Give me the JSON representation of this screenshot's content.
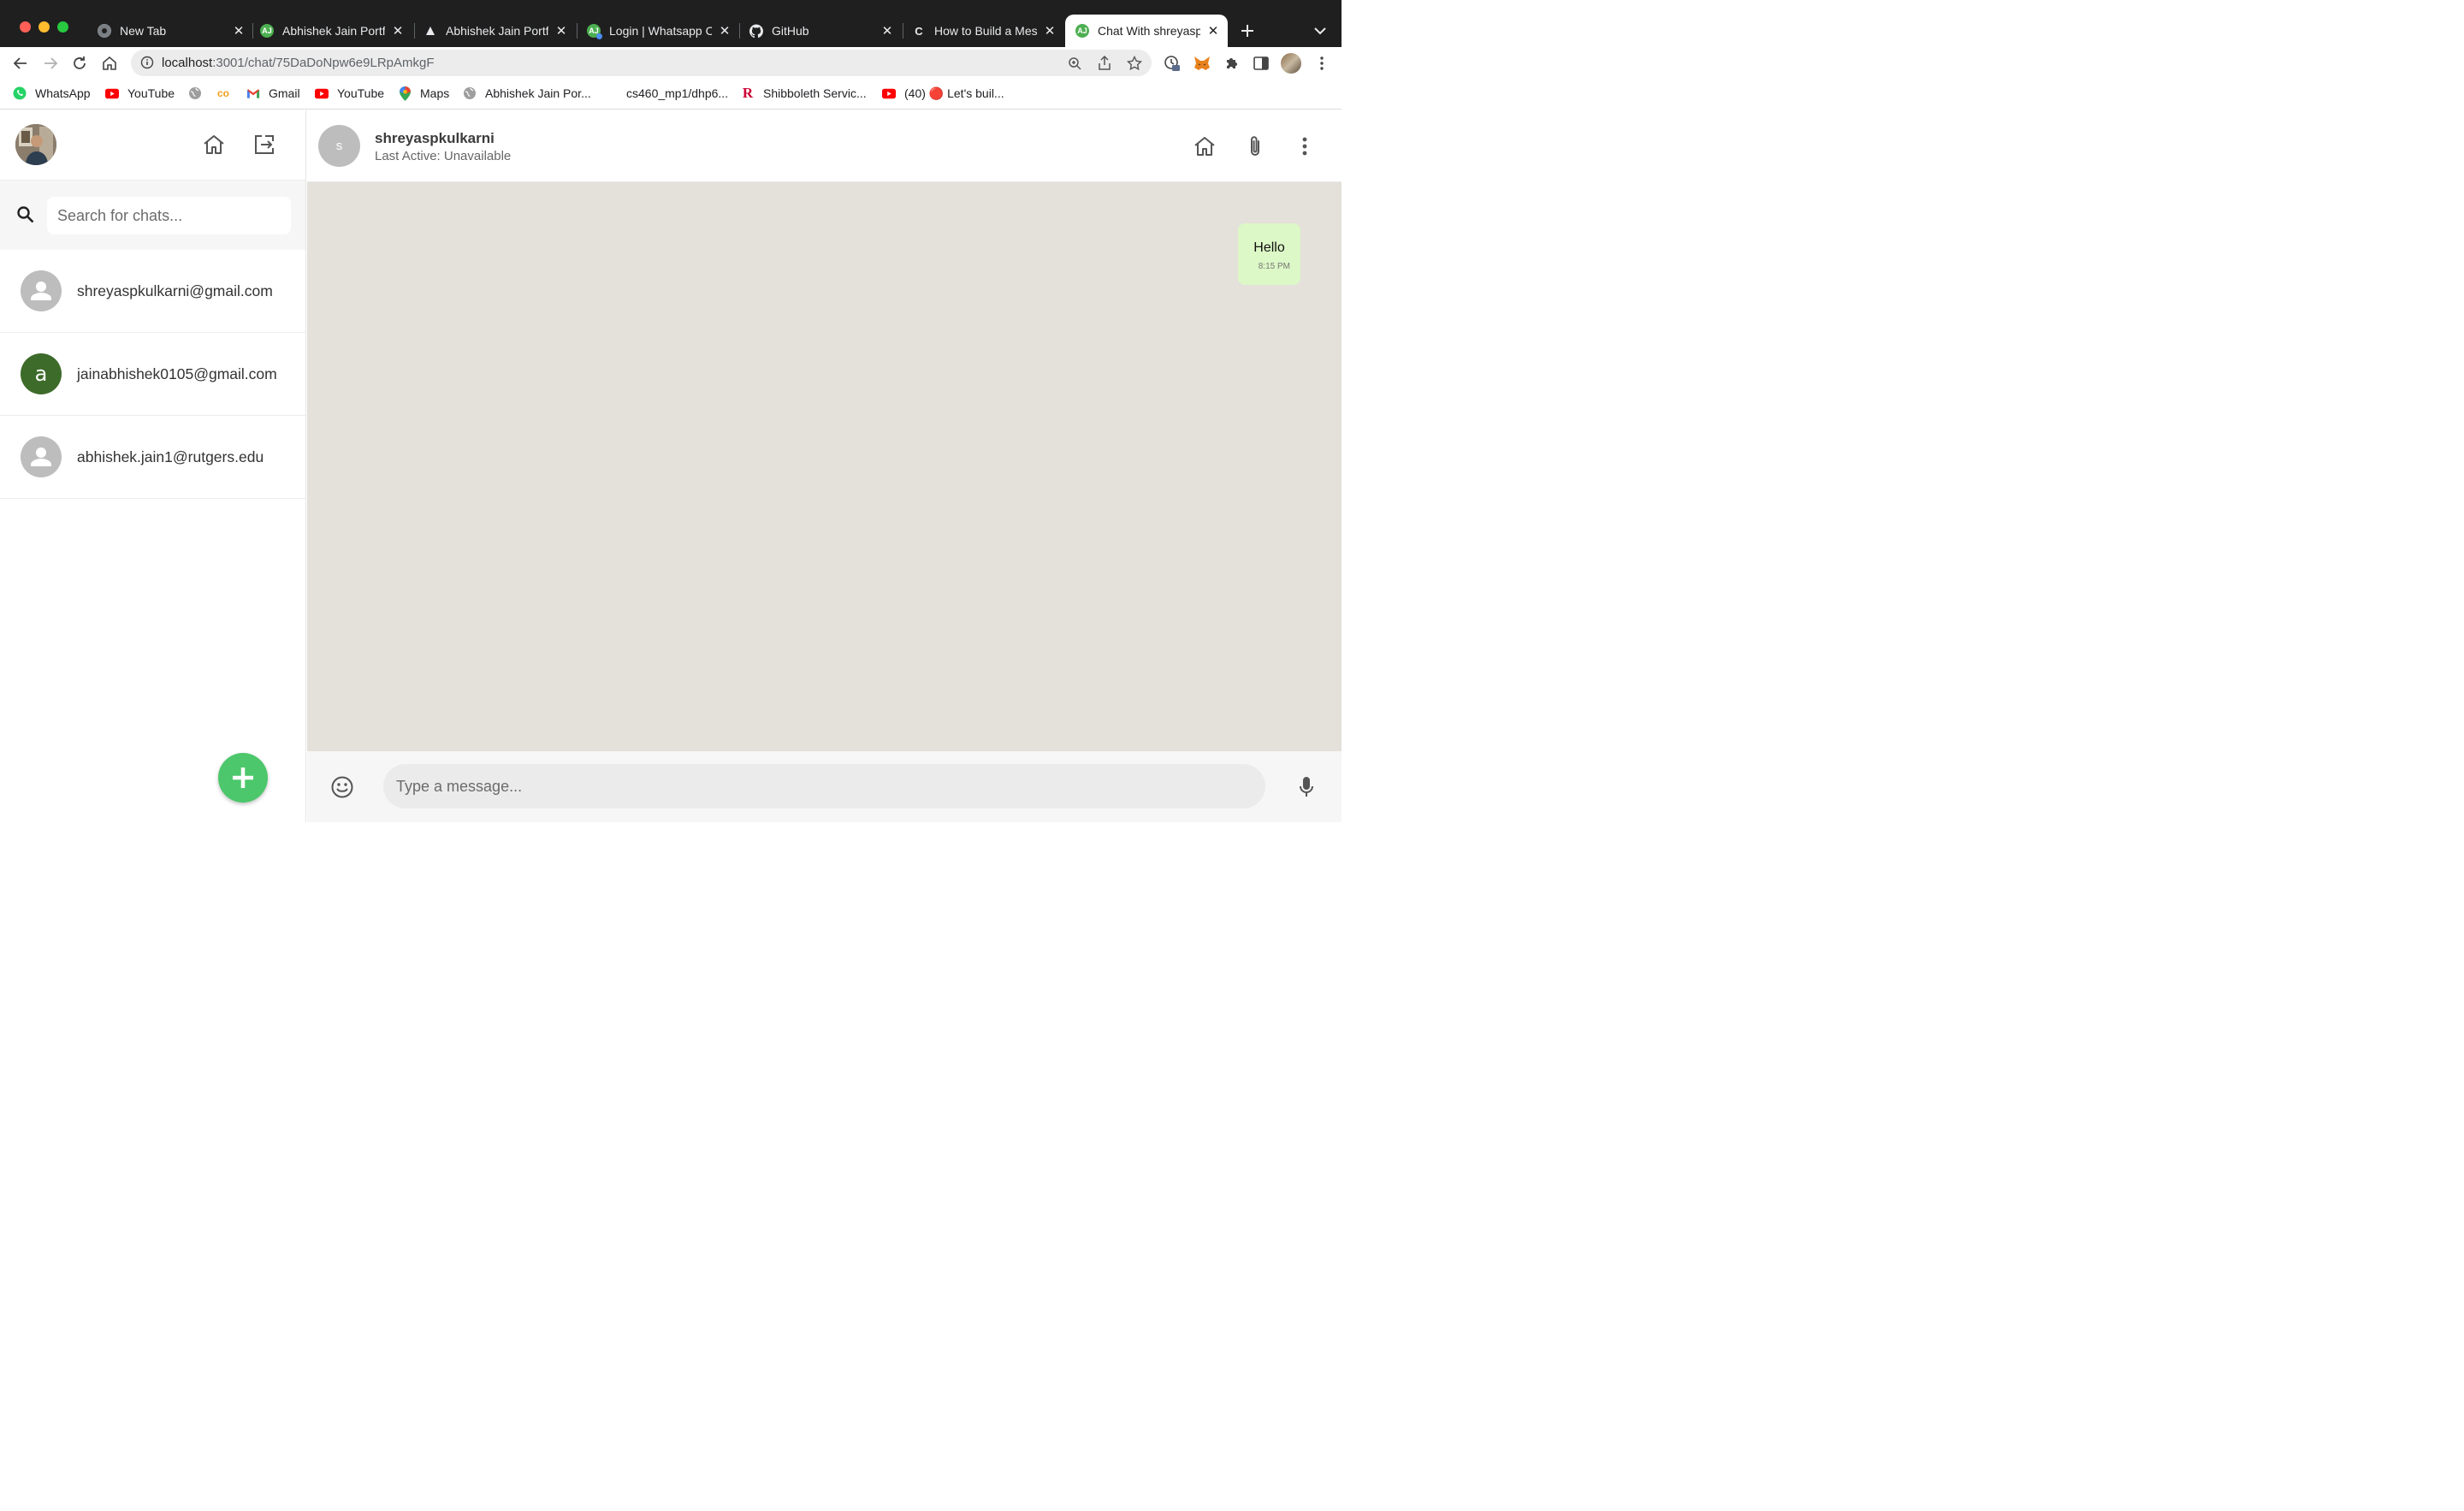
{
  "browser": {
    "tabs": [
      {
        "title": "New Tab",
        "icon": "chrome-icon"
      },
      {
        "title": "Abhishek Jain Portfolio",
        "icon": "portfolio-favicon"
      },
      {
        "title": "Abhishek Jain Portfolio",
        "icon": "vercel-triangle-icon"
      },
      {
        "title": "Login | Whatsapp Clone",
        "icon": "whatsapp-clone-favicon"
      },
      {
        "title": "GitHub",
        "icon": "github-icon"
      },
      {
        "title": "How to Build a Messaging App",
        "icon": "codecademy-icon"
      },
      {
        "title": "Chat With shreyaspkulkarni",
        "icon": "whatsapp-clone-favicon",
        "active": true
      }
    ],
    "url": {
      "host": "localhost",
      "path": ":3001/chat/75DaDoNpw6e9LRpAmkgF"
    },
    "bookmarks": [
      {
        "label": "WhatsApp",
        "icon": "whatsapp-icon"
      },
      {
        "label": "YouTube",
        "icon": "youtube-icon"
      },
      {
        "label": "",
        "icon": "globe-icon"
      },
      {
        "label": "",
        "icon": "coursera-icon"
      },
      {
        "label": "Gmail",
        "icon": "gmail-icon"
      },
      {
        "label": "YouTube",
        "icon": "youtube-icon"
      },
      {
        "label": "Maps",
        "icon": "maps-icon"
      },
      {
        "label": "Abhishek Jain Por...",
        "icon": "globe-icon"
      },
      {
        "label": "cs460_mp1/dhp6...",
        "icon": ""
      },
      {
        "label": "Shibboleth Servic...",
        "icon": "rutgers-icon"
      },
      {
        "label": "(40) 🔴 Let's buil...",
        "icon": "youtube-icon"
      }
    ]
  },
  "sidebar": {
    "search_placeholder": "Search for chats...",
    "chats": [
      {
        "name": "shreyaspkulkarni@gmail.com",
        "avatar": "person-icon"
      },
      {
        "name": "jainabhishek0105@gmail.com",
        "avatar_letter": "a"
      },
      {
        "name": "abhishek.jain1@rutgers.edu",
        "avatar": "person-icon"
      }
    ]
  },
  "chat": {
    "avatar_letter": "s",
    "name": "shreyaspkulkarni",
    "status": "Last Active: Unavailable",
    "messages": [
      {
        "text": "Hello",
        "time": "8:15 PM",
        "sent": true
      }
    ],
    "input_placeholder": "Type a message..."
  },
  "colors": {
    "accent_green": "#4cc76b",
    "bubble_green": "#dcf8c6",
    "chat_bg": "#e4e0da"
  }
}
